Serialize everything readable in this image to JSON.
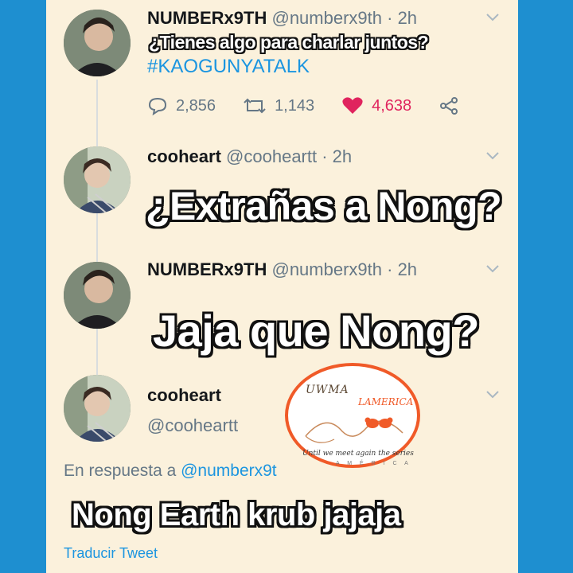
{
  "tweets": [
    {
      "name": "NUMBERx9TH",
      "handle": "@numberx9th",
      "time": "· 2h",
      "overlay": "¿Tienes algo para charlar juntos?",
      "hashtag": "#KAOGUNYATALK",
      "replies": "2,856",
      "retweets": "1,143",
      "likes": "4,638"
    },
    {
      "name": "cooheart",
      "handle": "@cooheartt",
      "time": "· 2h",
      "overlay": "¿Extrañas a Nong?"
    },
    {
      "name": "NUMBERx9TH",
      "handle": "@numberx9th",
      "time": "· 2h",
      "overlay": "Jaja que Nong?"
    },
    {
      "name": "cooheart",
      "handle": "@cooheartt",
      "reply_prefix": "En respuesta a",
      "reply_mention": "@numberx9t",
      "overlay": "Nong Earth krub jajaja",
      "translate": "Traducir Tweet"
    }
  ],
  "watermark": {
    "line1": "UWMA",
    "line2": "LAMERICA",
    "motto": "Until we meet again the series",
    "sub": "A M É R I C A"
  },
  "colors": {
    "background": "#1e8fd0",
    "panel": "#fbf1dc",
    "link": "#1b95e0",
    "like": "#e0245e",
    "stamp": "#f05a28"
  },
  "icons": [
    "reply-icon",
    "retweet-icon",
    "heart-icon",
    "share-icon",
    "chevron-down-icon"
  ]
}
